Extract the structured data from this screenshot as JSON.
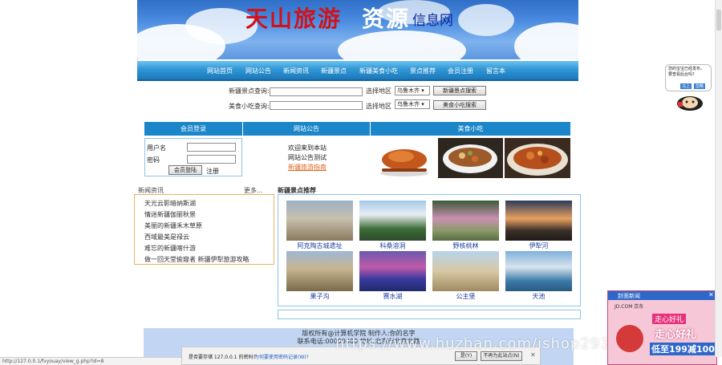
{
  "banner": {
    "title_part1": "天山旅游",
    "title_part2": "资源",
    "title_part3": "信息网"
  },
  "nav": [
    "网站首页",
    "网站公告",
    "新闻资讯",
    "新疆景点",
    "新疆美食小吃",
    "景点推荐",
    "会员注册",
    "留言本"
  ],
  "search": {
    "spot_label": "新疆景点查询:",
    "food_label": "美食小吃查询:",
    "region_label": "选择地区",
    "region_value": "乌鲁木齐",
    "spot_button": "新疆景点搜索",
    "food_button": "美食小吃搜索"
  },
  "sections": {
    "member": "会员登录",
    "notice": "网站公告",
    "food": "美食小吃"
  },
  "login": {
    "username_label": "用户名",
    "password_label": "密码",
    "login_button": "会员登陆",
    "register_link": "注册"
  },
  "notices": [
    "欢迎来到本站",
    "网站公告测试",
    "新疆旅游指南"
  ],
  "news": {
    "title": "新闻资讯",
    "more": "更多...",
    "items": [
      "天光云影暗纳斯湖",
      "情迷新疆伽丽秋景",
      "美丽的新疆禾木草原",
      "西域最美是禄云",
      "难忘的新疆喀什游",
      "做一回天堂偷窥者 新疆伊犁旅游攻略"
    ]
  },
  "spots": {
    "title": "新疆景点推荐",
    "items": [
      "阿克陶古城遗址",
      "科桑溶洞",
      "野核桃林",
      "伊犁河",
      "果子沟",
      "赛水湖",
      "公主堡",
      "天池"
    ]
  },
  "footer": {
    "line1": "版权所有@计算机学院  制作人:你的名字",
    "line2": "联系电话:00000000  地址:北京市北京北路"
  },
  "download": {
    "prompt": "是否要存储 127.0.0.1 的密码?",
    "link": "为何要使用密码记录(W)?",
    "yes": "是(Y)",
    "never": "不再为此站点(N)"
  },
  "status_url": "http://127.0.0.1/fvyouay/view_g.php?id=8",
  "watermark": "https://www.huzhan.com/ishop2939",
  "side_widget": {
    "text": "您的宝宝已经发布，\n要查看后台吗?",
    "btn1": "马上",
    "btn2": "忽略"
  },
  "ad": {
    "brand": "封面新闻",
    "shop": "JD.COM 京东",
    "headline": "走心好礼",
    "sub": "走心好礼",
    "price": "低至199减100"
  },
  "colors": {
    "nav_blue": "#1c78b8",
    "bar_blue": "#1b86c9",
    "title_red": "#d0121b",
    "link_orange": "#e2641a"
  }
}
